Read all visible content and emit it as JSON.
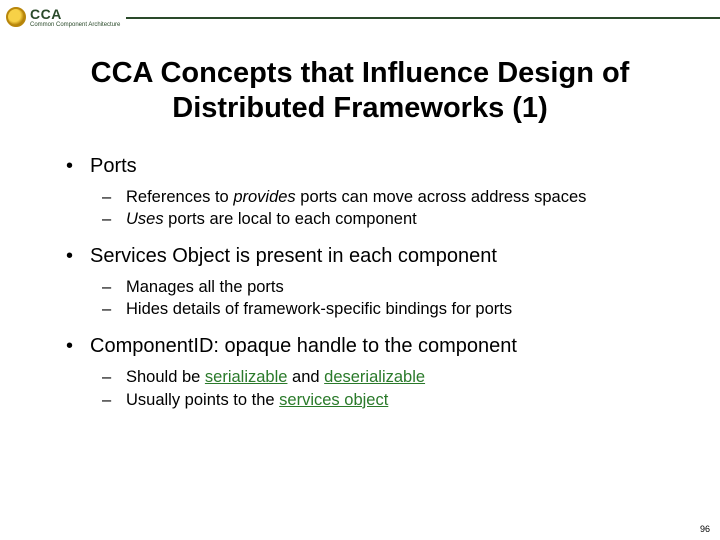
{
  "header": {
    "acronym": "CCA",
    "subtitle": "Common Component Architecture"
  },
  "title_line1": "CCA Concepts that Influence Design of",
  "title_line2": "Distributed Frameworks (1)",
  "bullets": {
    "b1": "Ports",
    "b1s1_pre": "References to ",
    "b1s1_em": "provides",
    "b1s1_post": " ports can move across address spaces",
    "b1s2_em": "Uses",
    "b1s2_post": " ports are local to each component",
    "b2": "Services Object is present in each component",
    "b2s1": "Manages all the ports",
    "b2s2": "Hides details of framework-specific bindings for  ports",
    "b3": "ComponentID: opaque handle to the component",
    "b3s1_pre": "Should be ",
    "b3s1_g1": "serializable",
    "b3s1_mid": " and ",
    "b3s1_g2": "deserializable",
    "b3s2_pre": "Usually points to the ",
    "b3s2_g": "services object"
  },
  "page_number": "96"
}
